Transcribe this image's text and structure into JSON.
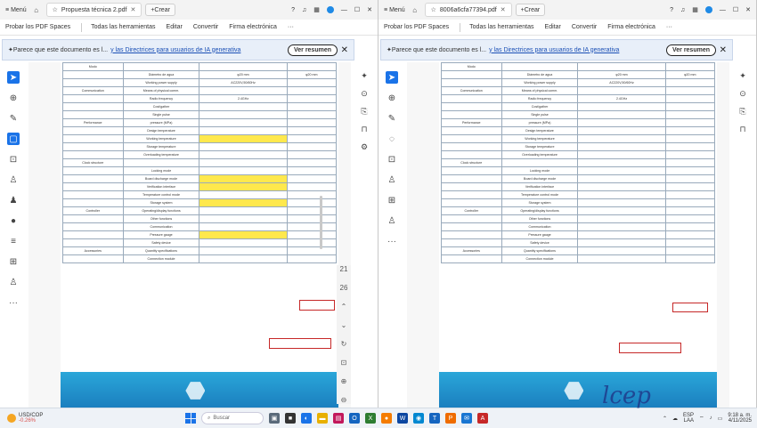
{
  "windows": [
    {
      "menu_label": "Menú",
      "tab_title": "Propuesta técnica 2.pdf",
      "new_tab_label": "Crear",
      "toolbar": [
        "Probar los PDF Spaces",
        "Todas las herramientas",
        "Editar",
        "Convertir",
        "Firma electrónica"
      ],
      "banner_text": "Parece que este documento es l...",
      "banner_link": "y las Directrices para usuarios de IA generativa",
      "banner_button": "Ver resumen"
    },
    {
      "menu_label": "Menú",
      "tab_title": "8006a6cfa77394.pdf",
      "new_tab_label": "Crear",
      "toolbar": [
        "Probar los PDF Spaces",
        "Todas las herramientas",
        "Editar",
        "Convertir",
        "Firma electrónica"
      ],
      "banner_text": "Parece que este documento es l...",
      "banner_link": "y las Directrices para usuarios de IA generativa",
      "banner_button": "Ver resumen"
    }
  ],
  "taskbar": {
    "weather_temp": "USD/COP",
    "weather_change": "-0.26%",
    "search_placeholder": "Buscar",
    "lang": "ESP",
    "lang_sub": "LAA",
    "time": "9:18 a. m.",
    "date": "4/11/2025"
  },
  "signature_text": "lcep",
  "table_left": [
    [
      "Modo",
      "",
      "",
      ""
    ],
    [
      "",
      "Diámetro de agua",
      "φ20 mm",
      "φ20 mm"
    ],
    [
      "",
      "Working power supply",
      "AC220V,50/60Hz",
      ""
    ],
    [
      "Communication",
      "Means of physical comm.",
      "",
      ""
    ],
    [
      "",
      "Radio frequency",
      "2.4GHz",
      ""
    ],
    [
      "",
      "Cost/gather",
      "",
      ""
    ],
    [
      "",
      "Single pulse",
      "",
      ""
    ],
    [
      "Performance",
      "pressure (MPa)",
      "",
      ""
    ],
    [
      "",
      "Design temperature",
      "",
      ""
    ],
    [
      "",
      "Working temperature",
      "",
      ""
    ],
    [
      "",
      "Storage temperature",
      "",
      ""
    ],
    [
      "",
      "Overloading temperature",
      "",
      ""
    ],
    [
      "Clock structure",
      "",
      "",
      ""
    ],
    [
      "",
      "Locking mode",
      "",
      ""
    ],
    [
      "",
      "Board discharge mode",
      "",
      ""
    ],
    [
      "",
      "Verification interface",
      "",
      ""
    ],
    [
      "",
      "Temperature control mode",
      "",
      ""
    ],
    [
      "",
      "Storage system",
      "",
      ""
    ],
    [
      "Controller",
      "Operating/display functions",
      "",
      ""
    ],
    [
      "",
      "Other functions",
      "",
      ""
    ],
    [
      "",
      "Communication",
      "",
      ""
    ],
    [
      "",
      "Pressure gauge",
      "",
      ""
    ],
    [
      "",
      "Safety device",
      "",
      ""
    ],
    [
      "Accessories",
      "Quantity specifications",
      "",
      ""
    ],
    [
      "",
      "Connection module",
      "",
      ""
    ]
  ]
}
